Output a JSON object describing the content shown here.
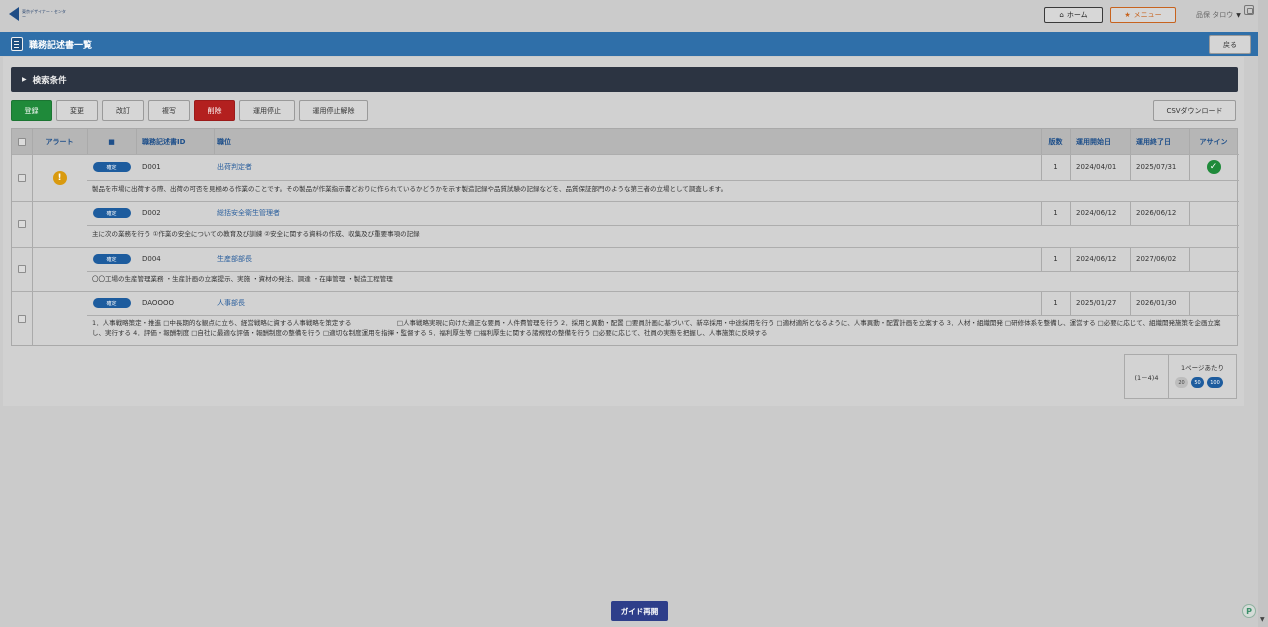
{
  "header": {
    "logo_text": "東京デザイナー・センター",
    "home_label": "ホーム",
    "menu_label": "メニュー",
    "user_name": "品保 タロウ"
  },
  "titlebar": {
    "title": "職務記述書一覧",
    "back_label": "戻る"
  },
  "search": {
    "label": "検索条件"
  },
  "actions": [
    "登録",
    "変更",
    "改訂",
    "複写",
    "削除",
    "運用停止",
    "運用停止解除"
  ],
  "csv_label": "CSVダウンロード",
  "table": {
    "headers": {
      "alert": "アラート",
      "mark": "■",
      "id": "職務記述書ID",
      "position": "職位",
      "version": "版数",
      "start": "運用開始日",
      "end": "運用終了日",
      "assign": "アサイン"
    },
    "rows": [
      {
        "status": "確定",
        "id": "D001",
        "position": "出荷判定者",
        "version": "1",
        "start": "2024/04/01",
        "end": "2025/07/31",
        "alert": true,
        "assigned": true,
        "desc": "製品を市場に出荷する際、出荷の可否を見極める作業のことです。その製品が作業指示書どおりに作られているかどうかを示す製造記録や品質試験の記録などを、品質保証部門のような第三者の立場として調査します。"
      },
      {
        "status": "確定",
        "id": "D002",
        "position": "総括安全衛生管理者",
        "version": "1",
        "start": "2024/06/12",
        "end": "2026/06/12",
        "alert": false,
        "assigned": false,
        "desc": "主に次の業務を行う ①作業の安全についての教育及び訓練 ②安全に関する資料の作成、収集及び重要事項の記録"
      },
      {
        "status": "確定",
        "id": "D004",
        "position": "生産部部長",
        "version": "1",
        "start": "2024/06/12",
        "end": "2027/06/02",
        "alert": false,
        "assigned": false,
        "desc": "〇〇工場の生産管理業務 ・生産計画の立案提示、実施 ・資材の発注、調達 ・在庫管理 ・製造工程管理"
      },
      {
        "status": "確定",
        "id": "DAOOOO",
        "position": "人事部長",
        "version": "1",
        "start": "2025/01/27",
        "end": "2026/01/30",
        "alert": false,
        "assigned": false,
        "desc": "1．人事戦略策定・推進 □中長期的な観点に立ち、経営戦略に資する人事戦略を策定する　　　　　　　□人事戦略実現に向けた適正な要員・人件費管理を行う 2．採用と異動・配置 □要員計画に基づいて、新卒採用・中途採用を行う □適材適所となるように、人事異動・配置計画を立案する 3．人材・組織開発 □研修体系を整備し、運営する □必要に応じて、組織開発施策を企画立案し、実行する 4．評価・報酬制度 □自社に最適な評価・報酬制度の整備を行う □適切な制度運用を指揮・監督する 5．福利厚生等 □福利厚生に関する諸規程の整備を行う □必要に応じて、社員の実態を把握し、人事施策に反映する"
      }
    ]
  },
  "pager": {
    "range": "(1－4)4",
    "per_page_label": "1ページあたり",
    "sizes": [
      "20",
      "50",
      "100"
    ],
    "active_size": "50"
  },
  "guide_label": "ガイド再開"
}
